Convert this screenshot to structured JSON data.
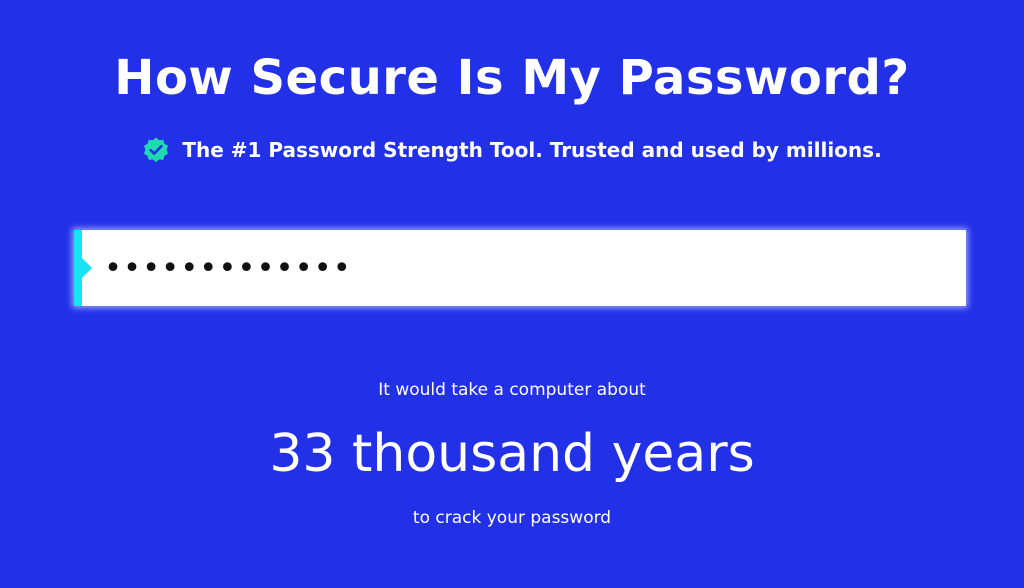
{
  "header": {
    "title": "How Secure Is My Password?",
    "tagline": "The #1 Password Strength Tool. Trusted and used by millions.",
    "badge_icon": "verified-check-icon",
    "badge_color": "#1fd9b0"
  },
  "password_field": {
    "value": "•••••••••••••",
    "marker_color": "#17e3f5"
  },
  "result": {
    "prefix": "It would take a computer about",
    "time": "33 thousand years",
    "suffix": "to crack your password"
  },
  "colors": {
    "background": "#2230e8",
    "text": "#ffffff"
  }
}
